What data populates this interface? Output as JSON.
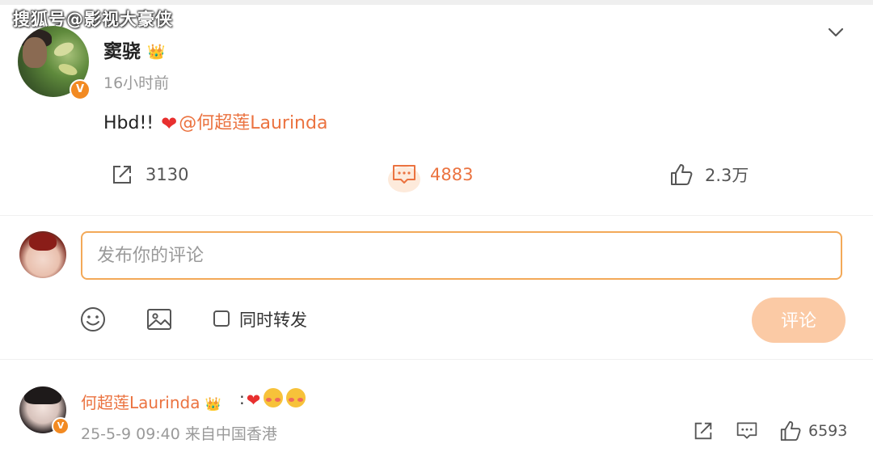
{
  "watermark": "搜狐号@影视大豪侠",
  "post": {
    "author": "窦骁",
    "time": "16小时前",
    "text_prefix": "Hbd!! ",
    "mention": "@何超莲Laurinda",
    "verified_badge": "V",
    "actions": {
      "repost_count": "3130",
      "comment_count": "4883",
      "like_count": "2.3万"
    }
  },
  "composer": {
    "placeholder": "发布你的评论",
    "repost_checkbox_label": "同时转发",
    "submit_label": "评论"
  },
  "comments": [
    {
      "author": "何超莲Laurinda",
      "text_sep": ":",
      "meta": "25-5-9 09:40 来自中国香港",
      "like_count": "6593"
    }
  ],
  "colors": {
    "accent": "#eb7340",
    "input_border": "#f3a958",
    "submit_bg": "#fbcaa5",
    "verified": "#f28a22",
    "heart": "#e8302f"
  },
  "icons": [
    "chevron-down-icon",
    "repost-icon",
    "comment-icon",
    "like-icon",
    "crown-icon",
    "heart-icon",
    "emoji-icon",
    "image-icon",
    "checkbox-icon"
  ]
}
